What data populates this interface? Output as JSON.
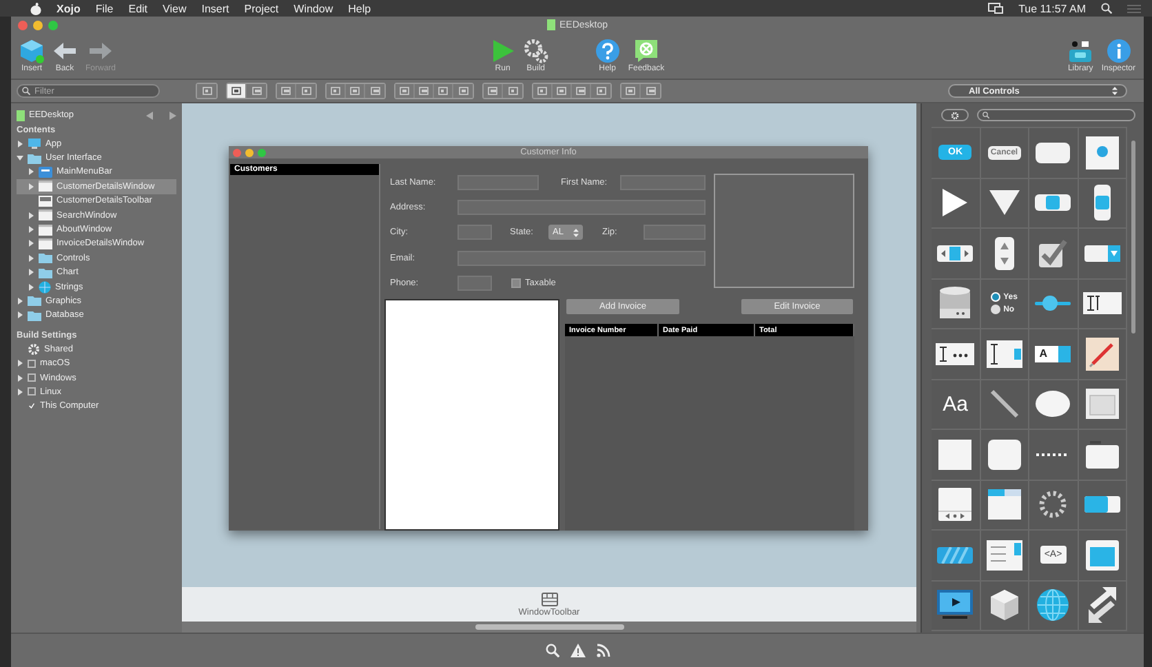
{
  "menu_bar": {
    "items": [
      "Xojo",
      "File",
      "Edit",
      "View",
      "Insert",
      "Project",
      "Window",
      "Help"
    ],
    "clock": "Tue 11:57 AM"
  },
  "window": {
    "title": "EEDesktop"
  },
  "toolbar": {
    "left": [
      {
        "label": "Insert",
        "kind": "insert",
        "disabled": false
      },
      {
        "label": "Back",
        "kind": "back",
        "disabled": false
      },
      {
        "label": "Forward",
        "kind": "forward",
        "disabled": true
      }
    ],
    "center": [
      {
        "label": "Run",
        "kind": "run",
        "disabled": false
      },
      {
        "label": "Build",
        "kind": "build",
        "disabled": false
      }
    ],
    "help": [
      {
        "label": "Help",
        "kind": "help",
        "disabled": false
      },
      {
        "label": "Feedback",
        "kind": "feedback",
        "disabled": false
      }
    ],
    "right": [
      {
        "label": "Library",
        "kind": "library",
        "disabled": false
      },
      {
        "label": "Inspector",
        "kind": "inspector",
        "disabled": false
      }
    ]
  },
  "filter": {
    "placeholder": "Filter"
  },
  "layout_tools": [
    [
      {
        "selected": false
      }
    ],
    [
      {
        "selected": true
      },
      {
        "selected": false
      }
    ],
    [
      {
        "selected": false
      },
      {
        "selected": false
      }
    ],
    [
      {
        "selected": false
      },
      {
        "selected": false
      },
      {
        "selected": false
      }
    ],
    [
      {
        "selected": false
      },
      {
        "selected": false
      },
      {
        "selected": false
      },
      {
        "selected": false
      }
    ],
    [
      {
        "selected": false
      },
      {
        "selected": false
      }
    ],
    [
      {
        "selected": false
      },
      {
        "selected": false
      },
      {
        "selected": false
      },
      {
        "selected": false
      }
    ],
    [
      {
        "selected": false
      },
      {
        "selected": false
      }
    ]
  ],
  "navigator": {
    "project": "EEDesktop",
    "contents_title": "Contents",
    "contents": [
      {
        "label": "App",
        "kind": "app",
        "expanded": false,
        "selected": false
      },
      {
        "label": "User Interface",
        "kind": "folder",
        "expanded": true,
        "selected": false,
        "children": [
          {
            "label": "MainMenuBar",
            "kind": "menubar",
            "expanded": false,
            "selected": false
          },
          {
            "label": "CustomerDetailsWindow",
            "kind": "window",
            "expanded": false,
            "selected": true
          },
          {
            "label": "CustomerDetailsToolbar",
            "kind": "toolbar",
            "selected": false
          },
          {
            "label": "SearchWindow",
            "kind": "window",
            "expanded": false,
            "selected": false
          },
          {
            "label": "AboutWindow",
            "kind": "window",
            "expanded": false,
            "selected": false
          },
          {
            "label": "InvoiceDetailsWindow",
            "kind": "window",
            "expanded": false,
            "selected": false
          },
          {
            "label": "Controls",
            "kind": "folder",
            "expanded": false,
            "selected": false
          },
          {
            "label": "Chart",
            "kind": "folder",
            "expanded": false,
            "selected": false
          },
          {
            "label": "Strings",
            "kind": "strings",
            "expanded": false,
            "selected": false
          }
        ]
      },
      {
        "label": "Graphics",
        "kind": "folder",
        "expanded": false,
        "selected": false
      },
      {
        "label": "Database",
        "kind": "folder",
        "expanded": false,
        "selected": false
      }
    ],
    "build_title": "Build Settings",
    "build": [
      {
        "label": "Shared",
        "kind": "shared",
        "selected": false
      },
      {
        "label": "macOS",
        "kind": "target",
        "expanded": false,
        "checked": false,
        "selected": false
      },
      {
        "label": "Windows",
        "kind": "target",
        "expanded": false,
        "checked": false,
        "selected": false
      },
      {
        "label": "Linux",
        "kind": "target",
        "expanded": false,
        "checked": false,
        "selected": false
      },
      {
        "label": "This Computer",
        "kind": "target",
        "checked": true,
        "selected": false
      }
    ]
  },
  "design_window": {
    "title": "Customer Info",
    "list_header": "Customers",
    "labels": {
      "last_name": "Last Name:",
      "first_name": "First Name:",
      "address": "Address:",
      "city": "City:",
      "state": "State:",
      "zip": "Zip:",
      "email": "Email:",
      "phone": "Phone:"
    },
    "state_value": "AL",
    "taxable": {
      "label": "Taxable",
      "checked": false
    },
    "buttons": [
      "Add Invoice",
      "Edit Invoice"
    ],
    "invoice_columns": [
      "Invoice Number",
      "Date Paid",
      "Total"
    ]
  },
  "tray": {
    "items": [
      {
        "label": "WindowToolbar"
      }
    ]
  },
  "library": {
    "filter": "All Controls",
    "items": [
      {
        "kind": "default-button",
        "label": "OK"
      },
      {
        "kind": "button",
        "label": "Cancel"
      },
      {
        "kind": "bevel-button"
      },
      {
        "kind": "canvas"
      },
      {
        "kind": "disclosure-right"
      },
      {
        "kind": "disclosure-down"
      },
      {
        "kind": "scrollbar-h"
      },
      {
        "kind": "scrollbar-v"
      },
      {
        "kind": "updown-h"
      },
      {
        "kind": "updown-v"
      },
      {
        "kind": "checkbox"
      },
      {
        "kind": "popup-menu"
      },
      {
        "kind": "database"
      },
      {
        "kind": "radio",
        "labels": [
          "Yes",
          "No"
        ]
      },
      {
        "kind": "slider"
      },
      {
        "kind": "text-field"
      },
      {
        "kind": "text-mask"
      },
      {
        "kind": "text-area"
      },
      {
        "kind": "combo-box",
        "label": "A"
      },
      {
        "kind": "color-picker"
      },
      {
        "kind": "label",
        "label": "Aa"
      },
      {
        "kind": "line"
      },
      {
        "kind": "oval"
      },
      {
        "kind": "window"
      },
      {
        "kind": "rectangle"
      },
      {
        "kind": "round-rectangle"
      },
      {
        "kind": "separator"
      },
      {
        "kind": "group-box"
      },
      {
        "kind": "page-panel"
      },
      {
        "kind": "tab-panel"
      },
      {
        "kind": "spinner"
      },
      {
        "kind": "progress-bar"
      },
      {
        "kind": "striped-bar"
      },
      {
        "kind": "list-box"
      },
      {
        "kind": "html",
        "label": "<A>"
      },
      {
        "kind": "container"
      },
      {
        "kind": "movie"
      },
      {
        "kind": "cube"
      },
      {
        "kind": "globe"
      },
      {
        "kind": "arrows"
      }
    ]
  }
}
